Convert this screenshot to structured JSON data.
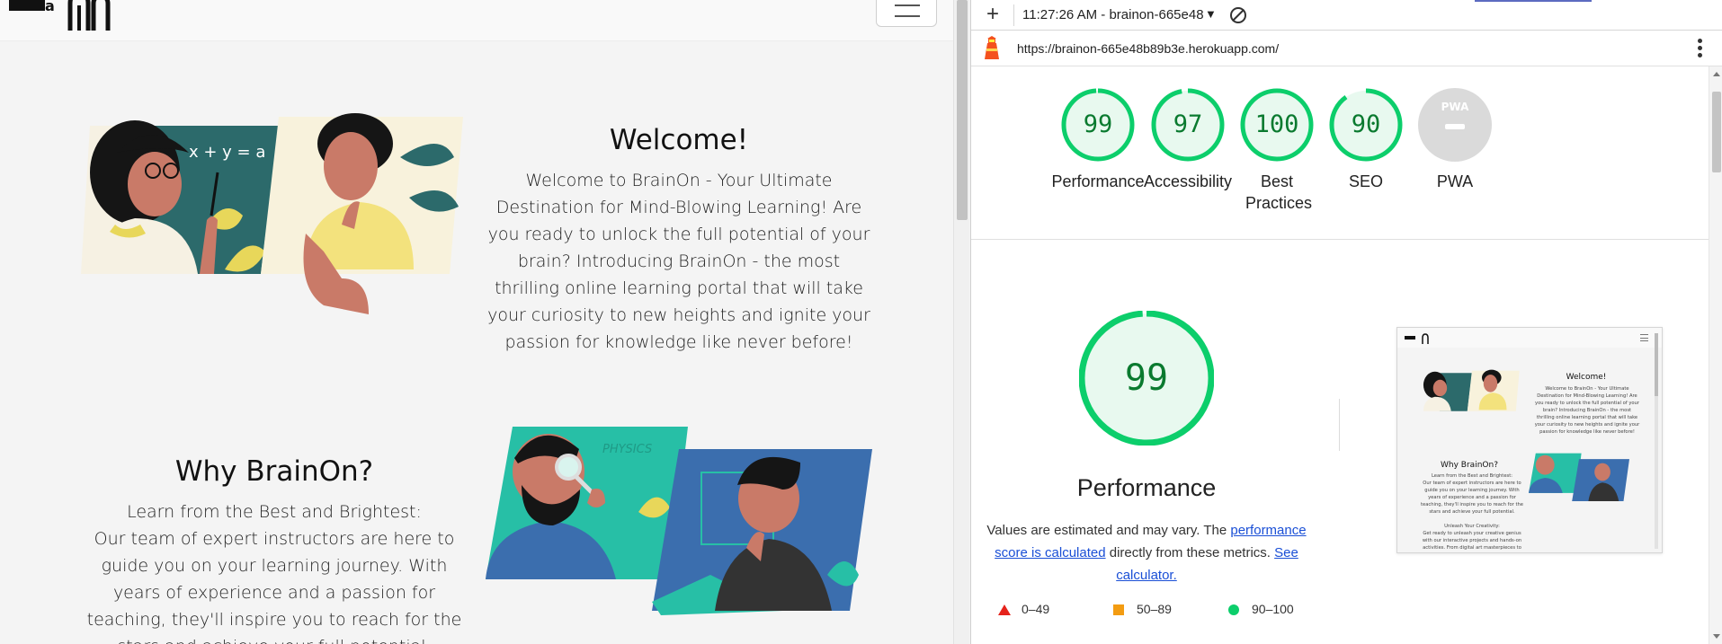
{
  "website": {
    "welcome_title": "Welcome!",
    "welcome_lines": [
      "Welcome to BrainOn - Your Ultimate",
      "Destination for Mind-Blowing Learning! Are",
      "you ready to unlock the full potential of your",
      "brain? Introducing BrainOn - the most",
      "thrilling online learning portal that will take",
      "your curiosity to new heights and ignite your",
      "passion for knowledge like never before!"
    ],
    "why_title": "Why BrainOn?",
    "why_lines": [
      "Learn from the Best and Brightest:",
      "Our team of expert instructors are here to",
      "guide you on your learning journey. With",
      "years of experience and a passion for",
      "teaching, they'll inspire you to reach for the",
      "stars and achieve your full potential."
    ],
    "illustration_formula": "x + y = a",
    "illustration_label": "PHYSICS",
    "menu_icon": "hamburger-icon"
  },
  "devtools": {
    "new_report_icon": "plus-icon",
    "report_label": "11:27:26 AM - brainon-665e48",
    "dropdown_icon": "triangle-down-icon",
    "clear_icon": "block-icon",
    "url": "https://brainon-665e48b89b3e.herokuapp.com/",
    "lighthouse_icon": "lighthouse-icon",
    "more_icon": "kebab-icon"
  },
  "lighthouse": {
    "categories": [
      {
        "label": "Performance",
        "score": "99",
        "value": 99
      },
      {
        "label": "Accessibility",
        "score": "97",
        "value": 97
      },
      {
        "label": "Best Practices",
        "score": "100",
        "value": 100
      },
      {
        "label": "SEO",
        "score": "90",
        "value": 90
      },
      {
        "label": "PWA",
        "score": "",
        "value": null,
        "badge": "PWA"
      }
    ],
    "main_score": "99",
    "main_title": "Performance",
    "desc_prefix": "Values are estimated and may vary. The ",
    "desc_link1": "performance score is calculated",
    "desc_middle": " directly from these metrics. ",
    "desc_link2": "See calculator.",
    "legend": [
      {
        "range": "0–49",
        "shape": "triangle",
        "color": "#e5231b"
      },
      {
        "range": "50–89",
        "shape": "square",
        "color": "#f39c12"
      },
      {
        "range": "90–100",
        "shape": "circle",
        "color": "#0cce6b"
      }
    ],
    "good_color": "#0cce6b",
    "good_fill": "#e8f9ef",
    "good_text": "#0a7a2f"
  },
  "thumbnail": {
    "welcome_title": "Welcome!",
    "welcome_lines": [
      "Welcome to BrainOn - Your Ultimate",
      "Destination for Mind-Blowing Learning! Are",
      "you ready to unlock the full potential of your",
      "brain? Introducing BrainOn - the most",
      "thrilling online learning portal that will take",
      "your curiosity to new heights and ignite your",
      "passion for knowledge like never before!"
    ],
    "why_title": "Why BrainOn?",
    "why_lines": [
      "Learn from the Best and Brightest:",
      "Our team of expert instructors are here to",
      "guide you on your learning journey. With",
      "years of experience and a passion for",
      "teaching, they'll inspire you to reach for the",
      "stars and achieve your full potential.",
      "",
      "Unleash Your Creativity:",
      "Get ready to unleash your creative genius",
      "with our interactive projects and hands-on",
      "activities. From digital art masterpieces to"
    ]
  }
}
